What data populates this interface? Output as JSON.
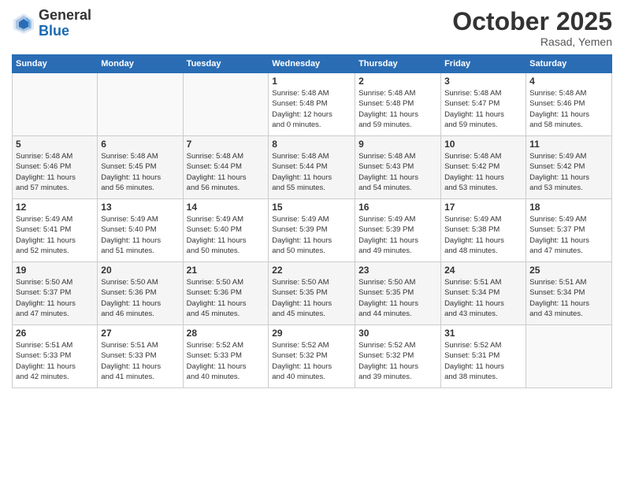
{
  "header": {
    "logo_line1": "General",
    "logo_line2": "Blue",
    "month": "October 2025",
    "location": "Rasad, Yemen"
  },
  "weekdays": [
    "Sunday",
    "Monday",
    "Tuesday",
    "Wednesday",
    "Thursday",
    "Friday",
    "Saturday"
  ],
  "weeks": [
    [
      {
        "day": "",
        "detail": ""
      },
      {
        "day": "",
        "detail": ""
      },
      {
        "day": "",
        "detail": ""
      },
      {
        "day": "1",
        "detail": "Sunrise: 5:48 AM\nSunset: 5:48 PM\nDaylight: 12 hours\nand 0 minutes."
      },
      {
        "day": "2",
        "detail": "Sunrise: 5:48 AM\nSunset: 5:48 PM\nDaylight: 11 hours\nand 59 minutes."
      },
      {
        "day": "3",
        "detail": "Sunrise: 5:48 AM\nSunset: 5:47 PM\nDaylight: 11 hours\nand 59 minutes."
      },
      {
        "day": "4",
        "detail": "Sunrise: 5:48 AM\nSunset: 5:46 PM\nDaylight: 11 hours\nand 58 minutes."
      }
    ],
    [
      {
        "day": "5",
        "detail": "Sunrise: 5:48 AM\nSunset: 5:46 PM\nDaylight: 11 hours\nand 57 minutes."
      },
      {
        "day": "6",
        "detail": "Sunrise: 5:48 AM\nSunset: 5:45 PM\nDaylight: 11 hours\nand 56 minutes."
      },
      {
        "day": "7",
        "detail": "Sunrise: 5:48 AM\nSunset: 5:44 PM\nDaylight: 11 hours\nand 56 minutes."
      },
      {
        "day": "8",
        "detail": "Sunrise: 5:48 AM\nSunset: 5:44 PM\nDaylight: 11 hours\nand 55 minutes."
      },
      {
        "day": "9",
        "detail": "Sunrise: 5:48 AM\nSunset: 5:43 PM\nDaylight: 11 hours\nand 54 minutes."
      },
      {
        "day": "10",
        "detail": "Sunrise: 5:48 AM\nSunset: 5:42 PM\nDaylight: 11 hours\nand 53 minutes."
      },
      {
        "day": "11",
        "detail": "Sunrise: 5:49 AM\nSunset: 5:42 PM\nDaylight: 11 hours\nand 53 minutes."
      }
    ],
    [
      {
        "day": "12",
        "detail": "Sunrise: 5:49 AM\nSunset: 5:41 PM\nDaylight: 11 hours\nand 52 minutes."
      },
      {
        "day": "13",
        "detail": "Sunrise: 5:49 AM\nSunset: 5:40 PM\nDaylight: 11 hours\nand 51 minutes."
      },
      {
        "day": "14",
        "detail": "Sunrise: 5:49 AM\nSunset: 5:40 PM\nDaylight: 11 hours\nand 50 minutes."
      },
      {
        "day": "15",
        "detail": "Sunrise: 5:49 AM\nSunset: 5:39 PM\nDaylight: 11 hours\nand 50 minutes."
      },
      {
        "day": "16",
        "detail": "Sunrise: 5:49 AM\nSunset: 5:39 PM\nDaylight: 11 hours\nand 49 minutes."
      },
      {
        "day": "17",
        "detail": "Sunrise: 5:49 AM\nSunset: 5:38 PM\nDaylight: 11 hours\nand 48 minutes."
      },
      {
        "day": "18",
        "detail": "Sunrise: 5:49 AM\nSunset: 5:37 PM\nDaylight: 11 hours\nand 47 minutes."
      }
    ],
    [
      {
        "day": "19",
        "detail": "Sunrise: 5:50 AM\nSunset: 5:37 PM\nDaylight: 11 hours\nand 47 minutes."
      },
      {
        "day": "20",
        "detail": "Sunrise: 5:50 AM\nSunset: 5:36 PM\nDaylight: 11 hours\nand 46 minutes."
      },
      {
        "day": "21",
        "detail": "Sunrise: 5:50 AM\nSunset: 5:36 PM\nDaylight: 11 hours\nand 45 minutes."
      },
      {
        "day": "22",
        "detail": "Sunrise: 5:50 AM\nSunset: 5:35 PM\nDaylight: 11 hours\nand 45 minutes."
      },
      {
        "day": "23",
        "detail": "Sunrise: 5:50 AM\nSunset: 5:35 PM\nDaylight: 11 hours\nand 44 minutes."
      },
      {
        "day": "24",
        "detail": "Sunrise: 5:51 AM\nSunset: 5:34 PM\nDaylight: 11 hours\nand 43 minutes."
      },
      {
        "day": "25",
        "detail": "Sunrise: 5:51 AM\nSunset: 5:34 PM\nDaylight: 11 hours\nand 43 minutes."
      }
    ],
    [
      {
        "day": "26",
        "detail": "Sunrise: 5:51 AM\nSunset: 5:33 PM\nDaylight: 11 hours\nand 42 minutes."
      },
      {
        "day": "27",
        "detail": "Sunrise: 5:51 AM\nSunset: 5:33 PM\nDaylight: 11 hours\nand 41 minutes."
      },
      {
        "day": "28",
        "detail": "Sunrise: 5:52 AM\nSunset: 5:33 PM\nDaylight: 11 hours\nand 40 minutes."
      },
      {
        "day": "29",
        "detail": "Sunrise: 5:52 AM\nSunset: 5:32 PM\nDaylight: 11 hours\nand 40 minutes."
      },
      {
        "day": "30",
        "detail": "Sunrise: 5:52 AM\nSunset: 5:32 PM\nDaylight: 11 hours\nand 39 minutes."
      },
      {
        "day": "31",
        "detail": "Sunrise: 5:52 AM\nSunset: 5:31 PM\nDaylight: 11 hours\nand 38 minutes."
      },
      {
        "day": "",
        "detail": ""
      }
    ]
  ]
}
